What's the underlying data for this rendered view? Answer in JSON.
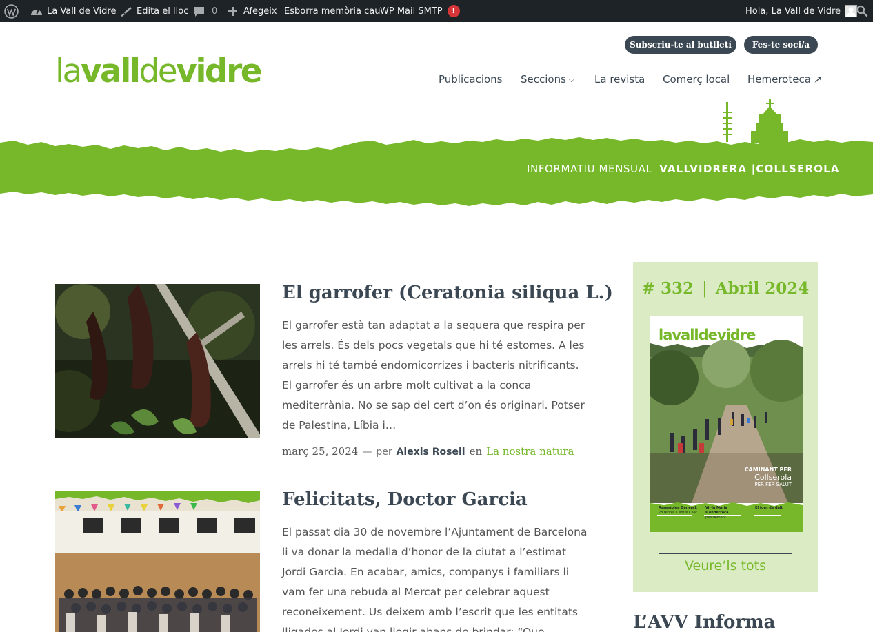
{
  "admin_bar": {
    "site_name": "La Vall de Vidre",
    "edit_site": "Edita el lloc",
    "comments_count": "0",
    "add_new": "Afegeix",
    "clear_cache": "Esborra memòria cau",
    "wp_mail_smtp": "WP Mail SMTP",
    "smtp_badge": "!",
    "greeting": "Hola, La Vall de Vidre"
  },
  "header": {
    "newsletter_button": "Subscriu-te al butlletí",
    "member_button": "Fes-te soci/a",
    "logo_light": "la",
    "logo_bold_1": "vall",
    "logo_light_2": "de",
    "logo_bold_2": "vidre",
    "nav": [
      {
        "label": "Publicacions"
      },
      {
        "label": "Seccions"
      },
      {
        "label": "La revista"
      },
      {
        "label": "Comerç local"
      },
      {
        "label": "Hemeroteca"
      }
    ],
    "tagline_light": "INFORMATIU MENSUAL",
    "tagline_bold": "VALLVIDRERA |COLLSEROLA"
  },
  "posts": [
    {
      "title": "El garrofer (Ceratonia siliqua L.)",
      "excerpt": "El garrofer està tan adaptat a la sequera que respira per les arrels. És dels pocs vegetals que hi té estomes. A les arrels hi té també endomicorrizes i bacteris nitrificants. El garrofer és un arbre molt cultivat a la conca mediterrània. No se sap del cert d’on és originari. Potser de Palestina, Líbia i…",
      "date": "març 25, 2024",
      "dash": "—",
      "per": "per",
      "author": "Alexis Rosell",
      "en": "en",
      "category": "La nostra natura"
    },
    {
      "title": "Felicitats, Doctor Garcia",
      "excerpt": "El passat dia 30 de novembre l’Ajuntament de Barcelona li va donar la medalla d’honor de la ciutat a l’estimat Jordi Garcia. En acabar, amics, companys i familiars li vam fer una rebuda al Mercat per celebrar aquest reconeixement. Us deixem amb l’escrit que les entitats lligades al Jordi van llegir abans de brindar: “Que"
    }
  ],
  "sidebar": {
    "issue_number": "# 332",
    "issue_sep": "|",
    "issue_month": "Abril 2024",
    "cover": {
      "logo": "lavalldevidre",
      "headline_1": "CAMINANT PER",
      "headline_2": "Collserola",
      "headline_3": "PER FER SALUT",
      "col1_title": "Assemblea General,",
      "col1_sub": "28 febrer. Centre Cívic",
      "col2_title": "Vil·la Maria s’enderroca",
      "col2_sub": "parcialment",
      "col3_title": "El forn de dalt"
    },
    "see_all": "Veure’ls tots",
    "next_widget_title": "L’AVV Informa"
  },
  "colors": {
    "brand_green": "#76b82a",
    "dark_slate": "#3b4853",
    "sidebar_bg": "#dbecc4",
    "admin_bg": "#1d2327"
  }
}
